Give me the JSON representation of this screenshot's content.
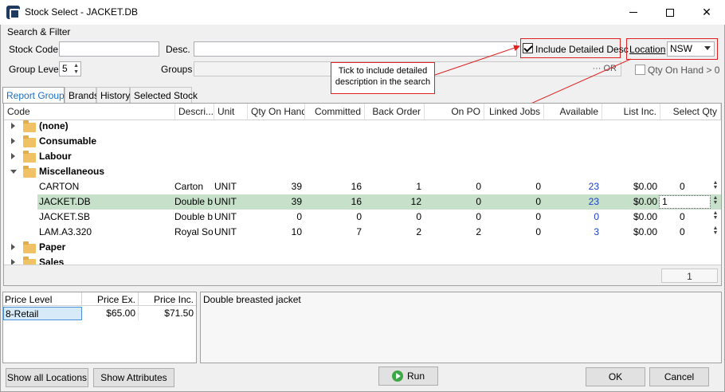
{
  "window": {
    "title": "Stock Select - JACKET.DB"
  },
  "search": {
    "section_label": "Search & Filter",
    "stock_code_label": "Stock Code",
    "stock_code_value": "",
    "desc_label": "Desc.",
    "desc_value": "",
    "include_detailed_desc_label": "Include Detailed Desc",
    "include_detailed_desc_checked": true,
    "location_label": "Location",
    "location_value": "NSW",
    "group_level_label": "Group Level",
    "group_level_value": "5",
    "groups_label": "Groups",
    "groups_suffix": "··· OR",
    "qty_on_hand_label": "Qty On Hand > 0",
    "qty_on_hand_checked": false
  },
  "callout": {
    "text": "Tick to include detailed description in the search"
  },
  "tabs": [
    {
      "label": "Report Groups",
      "active": true
    },
    {
      "label": "Brands",
      "active": false
    },
    {
      "label": "History",
      "active": false
    },
    {
      "label": "Selected Stock",
      "active": false
    }
  ],
  "grid": {
    "columns": [
      "Code",
      "Descri...",
      "Unit",
      "Qty On Hand",
      "Committed",
      "Back Order",
      "On PO",
      "Linked Jobs",
      "Available",
      "List Inc.",
      "Select Qty"
    ],
    "groups_top": [
      {
        "label": "(none)"
      },
      {
        "label": "Consumable"
      },
      {
        "label": "Labour"
      },
      {
        "label": "Miscellaneous"
      }
    ],
    "rows": [
      {
        "code": "CARTON",
        "desc": "Carton",
        "unit": "UNIT",
        "qty": "39",
        "committed": "16",
        "back_order": "1",
        "on_po": "0",
        "linked": "0",
        "available": "23",
        "list_inc": "$0.00",
        "select_qty": "0"
      },
      {
        "code": "JACKET.DB",
        "desc": "Double br",
        "unit": "UNIT",
        "qty": "39",
        "committed": "16",
        "back_order": "12",
        "on_po": "0",
        "linked": "0",
        "available": "23",
        "list_inc": "$0.00",
        "select_qty": "1"
      },
      {
        "code": "JACKET.SB",
        "desc": "Double br",
        "unit": "UNIT",
        "qty": "0",
        "committed": "0",
        "back_order": "0",
        "on_po": "0",
        "linked": "0",
        "available": "0",
        "list_inc": "$0.00",
        "select_qty": "0"
      },
      {
        "code": "LAM.A3.320",
        "desc": "Royal So",
        "unit": "UNIT",
        "qty": "10",
        "committed": "7",
        "back_order": "2",
        "on_po": "2",
        "linked": "0",
        "available": "3",
        "list_inc": "$0.00",
        "select_qty": "0"
      }
    ],
    "groups_bottom": [
      {
        "label": "Paper"
      },
      {
        "label": "Sales"
      }
    ],
    "footer_count": "1"
  },
  "price_table": {
    "columns": [
      "Price Level",
      "Price Ex.",
      "Price Inc."
    ],
    "rows": [
      {
        "level": "8-Retail",
        "ex": "$65.00",
        "inc": "$71.50"
      }
    ]
  },
  "description": {
    "text": "Double breasted jacket"
  },
  "buttons": {
    "show_all_locations": "Show all Locations",
    "show_attributes": "Show Attributes",
    "run": "Run",
    "ok": "OK",
    "cancel": "Cancel"
  },
  "colors": {
    "selected_row": "#c6e0c9",
    "accent_red": "#e02020",
    "link_blue": "#1a3fc4",
    "tab_active": "#1a6fc4"
  }
}
